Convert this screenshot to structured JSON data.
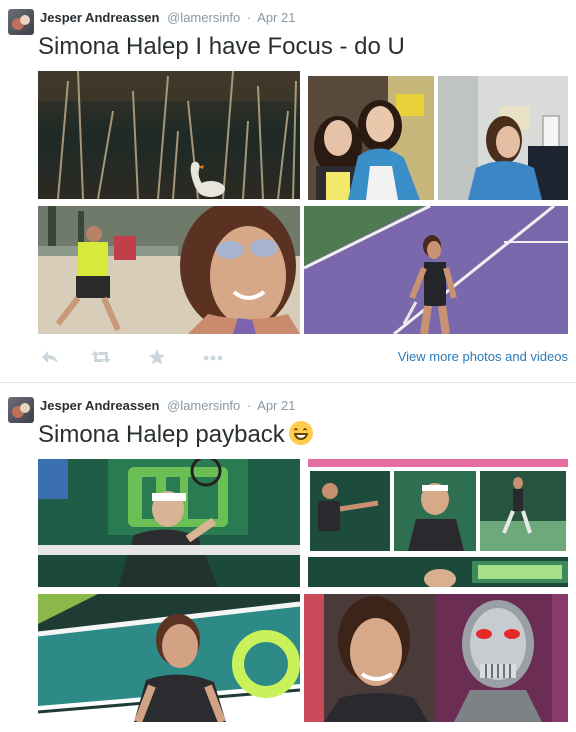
{
  "tweets": [
    {
      "author_name": "Jesper Andreassen",
      "handle": "@lamersinfo",
      "separator": "·",
      "date": "Apr 21",
      "text": "Simona Halep I have Focus - do U",
      "view_more_label": "View more photos and videos",
      "photos": [
        "lake-swan-reeds-photo",
        "two-women-selfie-photo",
        "woman-blue-jacket-photo",
        "beach-selfie-sunglasses-photo",
        "purple-court-player-photo"
      ]
    },
    {
      "author_name": "Jesper Andreassen",
      "handle": "@lamersinfo",
      "separator": "·",
      "date": "Apr 21",
      "text": "Simona Halep payback",
      "emoji": "grinning-face-emoji",
      "photos": [
        "tennis-forehand-green-wall-photo",
        "tennis-collage-miami-photo",
        "halep-teal-court-closeup-photo",
        "halep-vs-terminator-photo"
      ]
    }
  ],
  "icons": {
    "reply": "reply-icon",
    "retweet": "retweet-icon",
    "favorite": "star-icon",
    "more": "more-dots-icon"
  },
  "colors": {
    "link": "#2b7bb9",
    "muted": "#8899a6",
    "text": "#292f33",
    "action": "#ccd6dd"
  }
}
